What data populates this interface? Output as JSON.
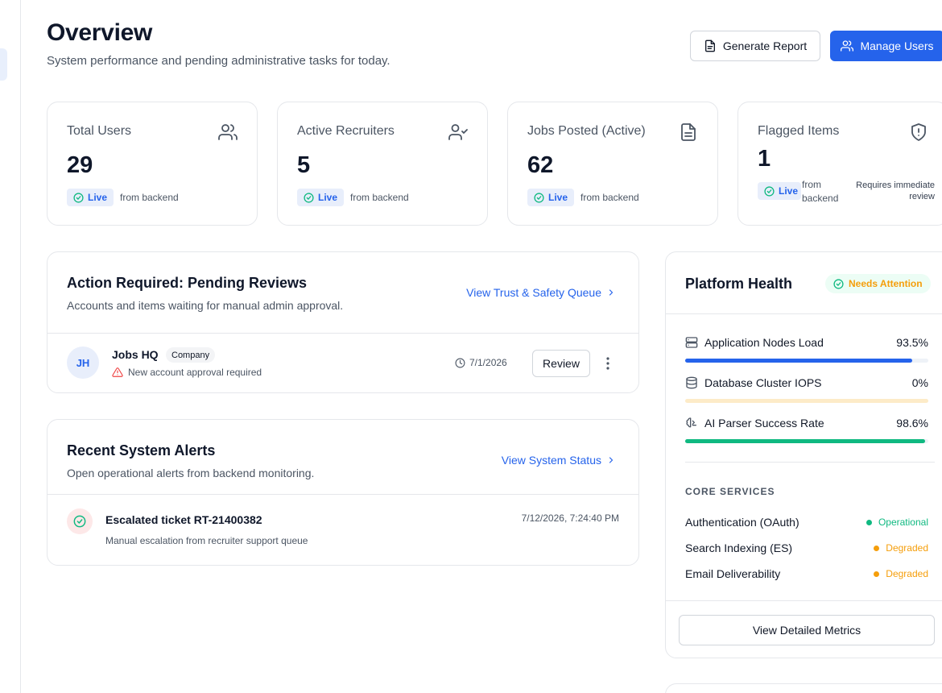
{
  "header": {
    "title": "Overview",
    "subtitle": "System performance and pending administrative tasks for today.",
    "generate_report_label": "Generate Report",
    "manage_users_label": "Manage Users"
  },
  "stats": [
    {
      "label": "Total Users",
      "value": "29",
      "badge": "Live",
      "source": "from backend",
      "icon": "users-icon"
    },
    {
      "label": "Active Recruiters",
      "value": "5",
      "badge": "Live",
      "source": "from backend",
      "icon": "user-check-icon"
    },
    {
      "label": "Jobs Posted (Active)",
      "value": "62",
      "badge": "Live",
      "source": "from backend",
      "icon": "document-icon"
    },
    {
      "label": "Flagged Items",
      "value": "1",
      "badge": "Live",
      "source": "from backend",
      "note": "Requires immediate review",
      "icon": "shield-alert-icon"
    }
  ],
  "pending": {
    "title": "Action Required: Pending Reviews",
    "subtitle": "Accounts and items waiting for manual admin approval.",
    "link": "View Trust & Safety Queue",
    "rows": [
      {
        "initials": "JH",
        "name": "Jobs HQ",
        "tag": "Company",
        "message": "New account approval required",
        "date": "7/1/2026",
        "action": "Review"
      }
    ]
  },
  "alerts": {
    "title": "Recent System Alerts",
    "subtitle": "Open operational alerts from backend monitoring.",
    "link": "View System Status",
    "rows": [
      {
        "title": "Escalated ticket RT-21400382",
        "description": "Manual escalation from recruiter support queue",
        "time": "7/12/2026, 7:24:40 PM"
      }
    ]
  },
  "health": {
    "title": "Platform Health",
    "badge": "Needs Attention",
    "metrics": [
      {
        "label": "Application Nodes Load",
        "value": "93.5%",
        "percent": 93.5,
        "color": "#2563eb",
        "track": "#eef2f7",
        "icon": "server-icon"
      },
      {
        "label": "Database Cluster IOPS",
        "value": "0%",
        "percent": 0,
        "color": "#f59e0b",
        "track": "#fdebc8",
        "icon": "database-icon"
      },
      {
        "label": "AI Parser Success Rate",
        "value": "98.6%",
        "percent": 98.6,
        "color": "#10b981",
        "track": "#eef2f7",
        "icon": "brain-icon"
      }
    ],
    "core_services_label": "CORE SERVICES",
    "services": [
      {
        "name": "Authentication (OAuth)",
        "status": "Operational",
        "color": "#10b981"
      },
      {
        "name": "Search Indexing (ES)",
        "status": "Degraded",
        "color": "#f59e0b"
      },
      {
        "name": "Email Deliverability",
        "status": "Degraded",
        "color": "#f59e0b"
      }
    ],
    "detail_button": "View Detailed Metrics"
  }
}
